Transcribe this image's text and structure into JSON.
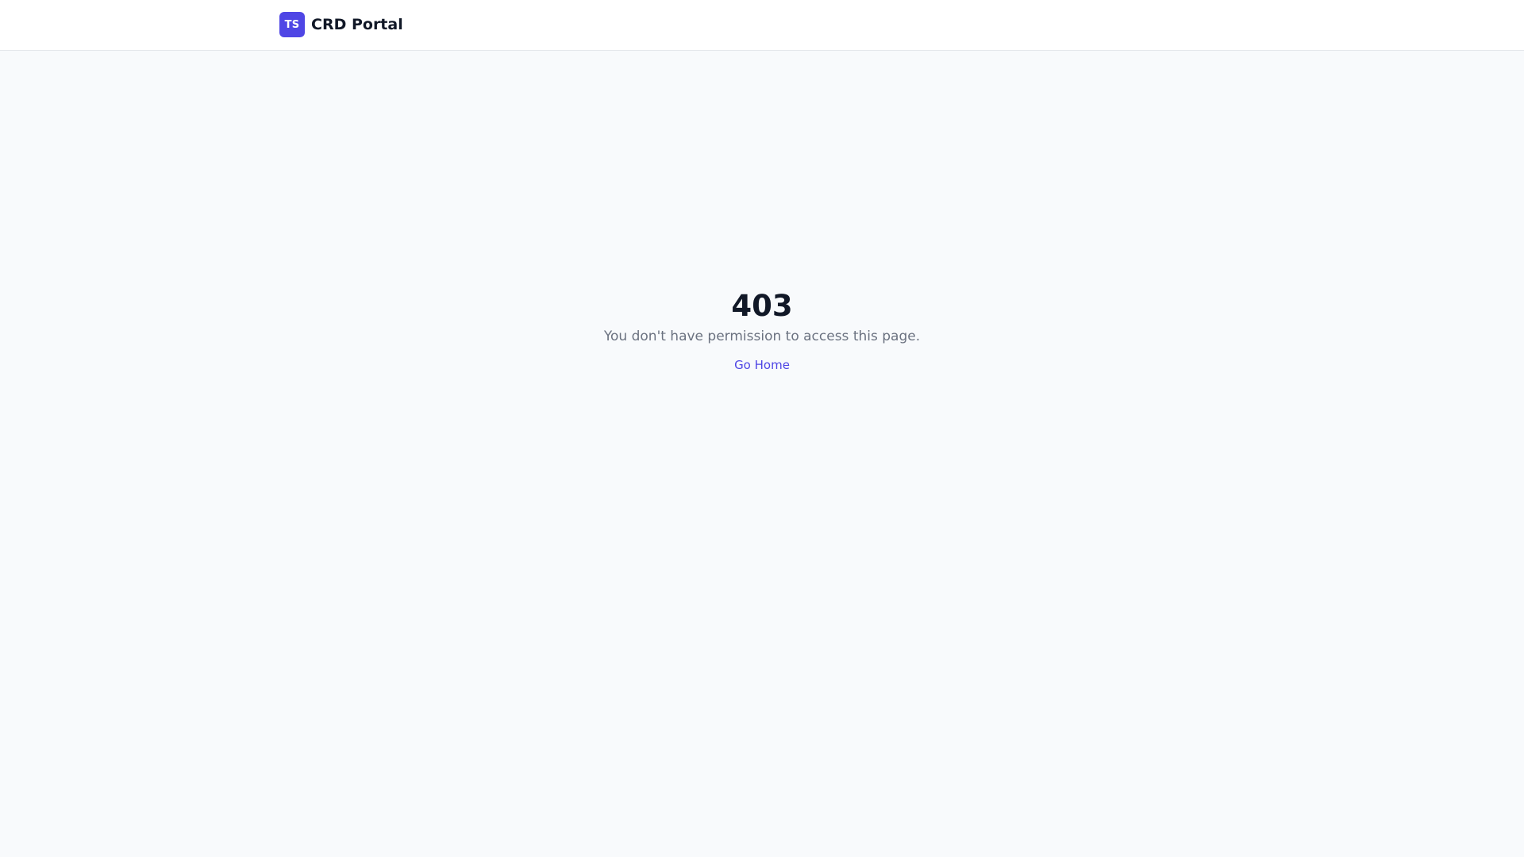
{
  "header": {
    "logo_initials": "TS",
    "app_name": "CRD Portal"
  },
  "error": {
    "code": "403",
    "message": "You don't have permission to access this page.",
    "home_link_label": "Go Home"
  },
  "colors": {
    "accent": "#4f46e5",
    "background": "#f8fafc",
    "header_background": "#ffffff",
    "heading_text": "#111827",
    "muted_text": "#6b7280"
  }
}
